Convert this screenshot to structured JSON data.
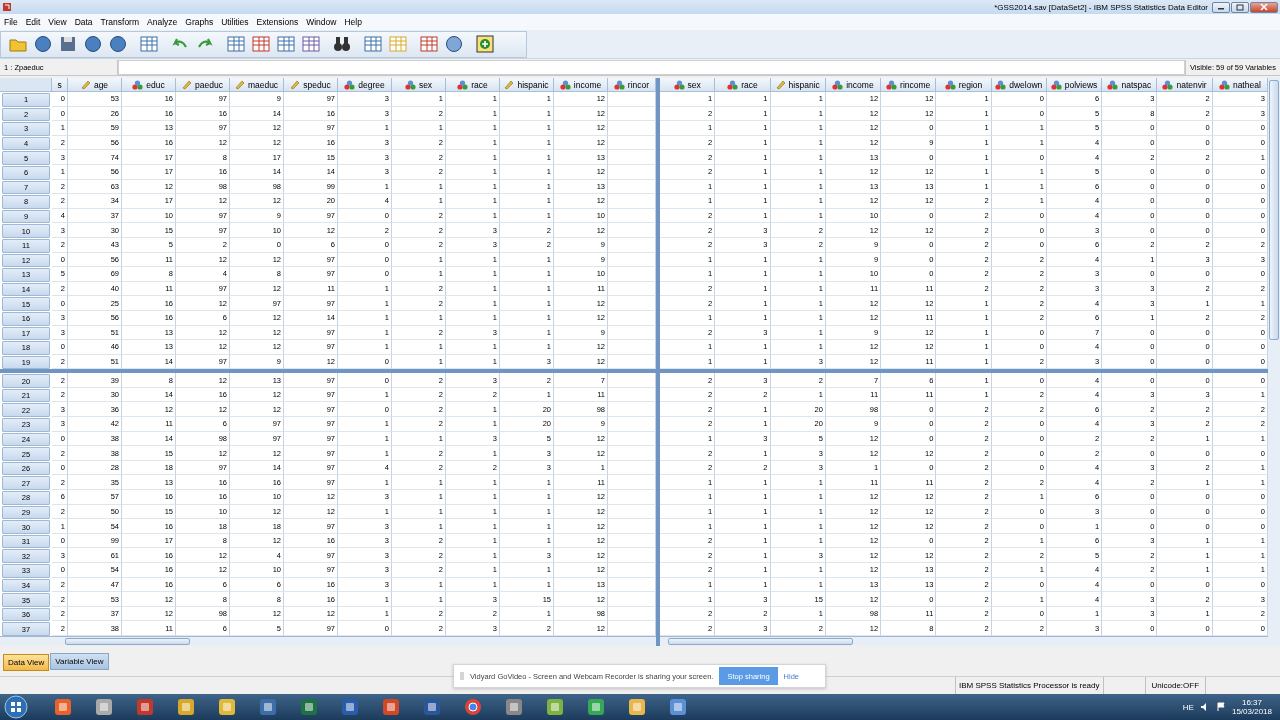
{
  "window": {
    "title": "*GSS2014.sav [DataSet2] - IBM SPSS Statistics Data Editor"
  },
  "menu": [
    "File",
    "Edit",
    "View",
    "Data",
    "Transform",
    "Analyze",
    "Graphs",
    "Utilities",
    "Extensions",
    "Window",
    "Help"
  ],
  "cell_reference": "1 : Zpaeduc",
  "visible_count": "Visible: 59 of 59 Variables",
  "left_columns": [
    {
      "name": "s"
    },
    {
      "name": "age",
      "kind": "scale"
    },
    {
      "name": "educ",
      "kind": "nominal"
    },
    {
      "name": "paeduc",
      "kind": "scale"
    },
    {
      "name": "maeduc",
      "kind": "scale"
    },
    {
      "name": "speduc",
      "kind": "scale"
    },
    {
      "name": "degree",
      "kind": "nominal"
    },
    {
      "name": "sex",
      "kind": "nominal"
    },
    {
      "name": "race",
      "kind": "nominal"
    },
    {
      "name": "hispanic",
      "kind": "scale"
    },
    {
      "name": "income",
      "kind": "nominal"
    },
    {
      "name": "rincor",
      "kind": "nominal"
    }
  ],
  "right_columns": [
    {
      "name": "sex",
      "kind": "nominal"
    },
    {
      "name": "race",
      "kind": "nominal"
    },
    {
      "name": "hispanic",
      "kind": "scale"
    },
    {
      "name": "income",
      "kind": "nominal"
    },
    {
      "name": "rincome",
      "kind": "nominal"
    },
    {
      "name": "region",
      "kind": "nominal"
    },
    {
      "name": "dwelown",
      "kind": "nominal"
    },
    {
      "name": "polviews",
      "kind": "nominal"
    },
    {
      "name": "natspac",
      "kind": "nominal"
    },
    {
      "name": "natenvir",
      "kind": "nominal"
    },
    {
      "name": "natheal",
      "kind": "nominal"
    }
  ],
  "top_left_rows": [
    {
      "number": "1",
      "cells": [
        "0",
        "53",
        "16",
        "97",
        "9",
        "97",
        "3",
        "1",
        "1",
        "1",
        "12"
      ]
    },
    {
      "number": "2",
      "cells": [
        "0",
        "26",
        "16",
        "16",
        "14",
        "16",
        "3",
        "2",
        "1",
        "1",
        "12"
      ]
    },
    {
      "number": "3",
      "cells": [
        "1",
        "59",
        "13",
        "97",
        "12",
        "97",
        "1",
        "1",
        "1",
        "1",
        "12"
      ]
    },
    {
      "number": "4",
      "cells": [
        "2",
        "56",
        "16",
        "12",
        "12",
        "16",
        "3",
        "2",
        "1",
        "1",
        "12"
      ]
    },
    {
      "number": "5",
      "cells": [
        "3",
        "74",
        "17",
        "8",
        "17",
        "15",
        "3",
        "2",
        "1",
        "1",
        "13"
      ]
    },
    {
      "number": "6",
      "cells": [
        "1",
        "56",
        "17",
        "16",
        "14",
        "14",
        "3",
        "2",
        "1",
        "1",
        "12"
      ]
    },
    {
      "number": "7",
      "cells": [
        "2",
        "63",
        "12",
        "98",
        "98",
        "99",
        "1",
        "1",
        "1",
        "1",
        "13"
      ]
    },
    {
      "number": "8",
      "cells": [
        "2",
        "34",
        "17",
        "12",
        "12",
        "20",
        "4",
        "1",
        "1",
        "1",
        "12"
      ]
    },
    {
      "number": "9",
      "cells": [
        "4",
        "37",
        "10",
        "97",
        "9",
        "97",
        "0",
        "2",
        "1",
        "1",
        "10"
      ]
    },
    {
      "number": "10",
      "cells": [
        "3",
        "30",
        "15",
        "97",
        "10",
        "12",
        "2",
        "2",
        "3",
        "2",
        "12"
      ]
    },
    {
      "number": "11",
      "cells": [
        "2",
        "43",
        "5",
        "2",
        "0",
        "6",
        "0",
        "2",
        "3",
        "2",
        "9"
      ]
    },
    {
      "number": "12",
      "cells": [
        "0",
        "56",
        "11",
        "12",
        "12",
        "97",
        "0",
        "1",
        "1",
        "1",
        "9"
      ]
    },
    {
      "number": "13",
      "cells": [
        "5",
        "69",
        "8",
        "4",
        "8",
        "97",
        "0",
        "1",
        "1",
        "1",
        "10"
      ]
    },
    {
      "number": "14",
      "cells": [
        "2",
        "40",
        "11",
        "97",
        "12",
        "11",
        "1",
        "2",
        "1",
        "1",
        "11"
      ]
    },
    {
      "number": "15",
      "cells": [
        "0",
        "25",
        "16",
        "12",
        "97",
        "97",
        "1",
        "2",
        "1",
        "1",
        "12"
      ]
    },
    {
      "number": "16",
      "cells": [
        "3",
        "56",
        "16",
        "6",
        "12",
        "14",
        "1",
        "1",
        "1",
        "1",
        "12"
      ]
    },
    {
      "number": "17",
      "cells": [
        "3",
        "51",
        "13",
        "12",
        "12",
        "97",
        "1",
        "2",
        "3",
        "1",
        "9"
      ]
    },
    {
      "number": "18",
      "cells": [
        "0",
        "46",
        "13",
        "12",
        "12",
        "97",
        "1",
        "1",
        "1",
        "1",
        "12"
      ]
    },
    {
      "number": "19",
      "cells": [
        "2",
        "51",
        "14",
        "97",
        "9",
        "12",
        "0",
        "1",
        "1",
        "3",
        "12"
      ]
    }
  ],
  "top_right_rows": [
    [
      "1",
      "1",
      "1",
      "12",
      "12",
      "1",
      "0",
      "6",
      "3",
      "2",
      "3"
    ],
    [
      "2",
      "1",
      "1",
      "12",
      "12",
      "1",
      "0",
      "5",
      "8",
      "2",
      "3"
    ],
    [
      "1",
      "1",
      "1",
      "12",
      "0",
      "1",
      "1",
      "5",
      "0",
      "0",
      "0"
    ],
    [
      "2",
      "1",
      "1",
      "12",
      "9",
      "1",
      "1",
      "4",
      "0",
      "0",
      "0"
    ],
    [
      "2",
      "1",
      "1",
      "13",
      "0",
      "1",
      "0",
      "4",
      "2",
      "2",
      "1"
    ],
    [
      "2",
      "1",
      "1",
      "12",
      "12",
      "1",
      "1",
      "5",
      "0",
      "0",
      "0"
    ],
    [
      "1",
      "1",
      "1",
      "13",
      "13",
      "1",
      "1",
      "6",
      "0",
      "0",
      "0"
    ],
    [
      "1",
      "1",
      "1",
      "12",
      "12",
      "2",
      "1",
      "4",
      "0",
      "0",
      "0"
    ],
    [
      "2",
      "1",
      "1",
      "10",
      "0",
      "2",
      "0",
      "4",
      "0",
      "0",
      "0"
    ],
    [
      "2",
      "3",
      "2",
      "12",
      "12",
      "2",
      "0",
      "3",
      "0",
      "0",
      "0"
    ],
    [
      "2",
      "3",
      "2",
      "9",
      "0",
      "2",
      "0",
      "6",
      "2",
      "2",
      "2"
    ],
    [
      "1",
      "1",
      "1",
      "9",
      "0",
      "2",
      "2",
      "4",
      "1",
      "3",
      "3"
    ],
    [
      "1",
      "1",
      "1",
      "10",
      "0",
      "2",
      "2",
      "3",
      "0",
      "0",
      "0"
    ],
    [
      "2",
      "1",
      "1",
      "11",
      "11",
      "2",
      "2",
      "3",
      "3",
      "2",
      "2"
    ],
    [
      "2",
      "1",
      "1",
      "12",
      "12",
      "1",
      "2",
      "4",
      "3",
      "1",
      "1"
    ],
    [
      "1",
      "1",
      "1",
      "12",
      "11",
      "1",
      "2",
      "6",
      "1",
      "2",
      "2"
    ],
    [
      "2",
      "3",
      "1",
      "9",
      "12",
      "1",
      "0",
      "7",
      "0",
      "0",
      "0"
    ],
    [
      "1",
      "1",
      "1",
      "12",
      "12",
      "1",
      "0",
      "4",
      "0",
      "0",
      "0"
    ],
    [
      "1",
      "1",
      "3",
      "12",
      "11",
      "1",
      "2",
      "3",
      "0",
      "0",
      "0"
    ]
  ],
  "bottom_left_rows": [
    {
      "number": "20",
      "cells": [
        "2",
        "39",
        "8",
        "12",
        "13",
        "97",
        "0",
        "2",
        "3",
        "2",
        "7"
      ]
    },
    {
      "number": "21",
      "cells": [
        "2",
        "30",
        "14",
        "16",
        "12",
        "97",
        "1",
        "2",
        "2",
        "1",
        "11"
      ]
    },
    {
      "number": "22",
      "cells": [
        "3",
        "36",
        "12",
        "12",
        "12",
        "97",
        "0",
        "2",
        "1",
        "20",
        "98"
      ]
    },
    {
      "number": "23",
      "cells": [
        "3",
        "42",
        "11",
        "6",
        "97",
        "97",
        "1",
        "2",
        "1",
        "20",
        "9"
      ]
    },
    {
      "number": "24",
      "cells": [
        "0",
        "38",
        "14",
        "98",
        "97",
        "97",
        "1",
        "1",
        "3",
        "5",
        "12"
      ]
    },
    {
      "number": "25",
      "cells": [
        "2",
        "38",
        "15",
        "12",
        "12",
        "97",
        "1",
        "2",
        "1",
        "3",
        "12"
      ]
    },
    {
      "number": "26",
      "cells": [
        "0",
        "28",
        "18",
        "97",
        "14",
        "97",
        "4",
        "2",
        "2",
        "3",
        "1"
      ]
    },
    {
      "number": "27",
      "cells": [
        "2",
        "35",
        "13",
        "16",
        "16",
        "97",
        "1",
        "1",
        "1",
        "1",
        "11"
      ]
    },
    {
      "number": "28",
      "cells": [
        "6",
        "57",
        "16",
        "16",
        "10",
        "12",
        "3",
        "1",
        "1",
        "1",
        "12"
      ]
    },
    {
      "number": "29",
      "cells": [
        "2",
        "50",
        "15",
        "10",
        "12",
        "12",
        "1",
        "1",
        "1",
        "1",
        "12"
      ]
    },
    {
      "number": "30",
      "cells": [
        "1",
        "54",
        "16",
        "18",
        "18",
        "97",
        "3",
        "1",
        "1",
        "1",
        "12"
      ]
    },
    {
      "number": "31",
      "cells": [
        "0",
        "99",
        "17",
        "8",
        "12",
        "16",
        "3",
        "2",
        "1",
        "1",
        "12"
      ]
    },
    {
      "number": "32",
      "cells": [
        "3",
        "61",
        "16",
        "12",
        "4",
        "97",
        "3",
        "2",
        "1",
        "3",
        "12"
      ]
    },
    {
      "number": "33",
      "cells": [
        "0",
        "54",
        "16",
        "12",
        "10",
        "97",
        "3",
        "2",
        "1",
        "1",
        "12"
      ]
    },
    {
      "number": "34",
      "cells": [
        "2",
        "47",
        "16",
        "6",
        "6",
        "16",
        "3",
        "1",
        "1",
        "1",
        "13"
      ]
    },
    {
      "number": "35",
      "cells": [
        "2",
        "53",
        "12",
        "8",
        "8",
        "16",
        "1",
        "1",
        "3",
        "15",
        "12"
      ]
    },
    {
      "number": "36",
      "cells": [
        "2",
        "37",
        "12",
        "98",
        "12",
        "12",
        "1",
        "2",
        "2",
        "1",
        "98"
      ]
    },
    {
      "number": "37",
      "cells": [
        "2",
        "38",
        "11",
        "6",
        "5",
        "97",
        "0",
        "2",
        "3",
        "2",
        "12"
      ]
    }
  ],
  "bottom_right_rows": [
    [
      "2",
      "3",
      "2",
      "7",
      "6",
      "1",
      "0",
      "4",
      "0",
      "0",
      "0"
    ],
    [
      "2",
      "2",
      "1",
      "11",
      "11",
      "1",
      "2",
      "4",
      "3",
      "3",
      "1"
    ],
    [
      "2",
      "1",
      "20",
      "98",
      "0",
      "2",
      "2",
      "6",
      "2",
      "2",
      "2"
    ],
    [
      "2",
      "1",
      "20",
      "9",
      "0",
      "2",
      "0",
      "4",
      "3",
      "2",
      "2"
    ],
    [
      "1",
      "3",
      "5",
      "12",
      "0",
      "2",
      "0",
      "2",
      "2",
      "1",
      "1"
    ],
    [
      "2",
      "1",
      "3",
      "12",
      "12",
      "2",
      "0",
      "2",
      "0",
      "0",
      "0"
    ],
    [
      "2",
      "2",
      "3",
      "1",
      "0",
      "2",
      "0",
      "4",
      "3",
      "2",
      "1"
    ],
    [
      "1",
      "1",
      "1",
      "11",
      "11",
      "2",
      "2",
      "4",
      "2",
      "1",
      "1"
    ],
    [
      "1",
      "1",
      "1",
      "12",
      "12",
      "2",
      "1",
      "6",
      "0",
      "0",
      "0"
    ],
    [
      "1",
      "1",
      "1",
      "12",
      "12",
      "2",
      "0",
      "3",
      "0",
      "0",
      "0"
    ],
    [
      "1",
      "1",
      "1",
      "12",
      "12",
      "2",
      "0",
      "1",
      "0",
      "0",
      "0"
    ],
    [
      "2",
      "1",
      "1",
      "12",
      "0",
      "2",
      "1",
      "6",
      "3",
      "1",
      "1"
    ],
    [
      "2",
      "1",
      "3",
      "12",
      "12",
      "2",
      "2",
      "5",
      "2",
      "1",
      "1"
    ],
    [
      "2",
      "1",
      "1",
      "12",
      "13",
      "2",
      "1",
      "4",
      "2",
      "1",
      "1"
    ],
    [
      "1",
      "1",
      "1",
      "13",
      "13",
      "2",
      "0",
      "4",
      "0",
      "0",
      "0"
    ],
    [
      "1",
      "3",
      "15",
      "12",
      "0",
      "2",
      "1",
      "4",
      "3",
      "2",
      "3"
    ],
    [
      "2",
      "2",
      "1",
      "98",
      "11",
      "2",
      "0",
      "1",
      "3",
      "1",
      "2"
    ],
    [
      "2",
      "3",
      "2",
      "12",
      "8",
      "2",
      "2",
      "3",
      "0",
      "0",
      "0"
    ]
  ],
  "view_tabs": [
    {
      "label": "Data View",
      "selected": true
    },
    {
      "label": "Variable View",
      "selected": false
    }
  ],
  "notification": {
    "message": "Vidyard GoVideo - Screen and Webcam Recorder is sharing your screen.",
    "primary_button": "Stop sharing",
    "secondary_link": "Hide"
  },
  "status_bar": {
    "processor": "IBM SPSS Statistics Processor is ready",
    "unicode": "Unicode:OFF"
  },
  "taskbar": {
    "language": "HE",
    "time": "16:37",
    "date": "15/03/2018"
  }
}
